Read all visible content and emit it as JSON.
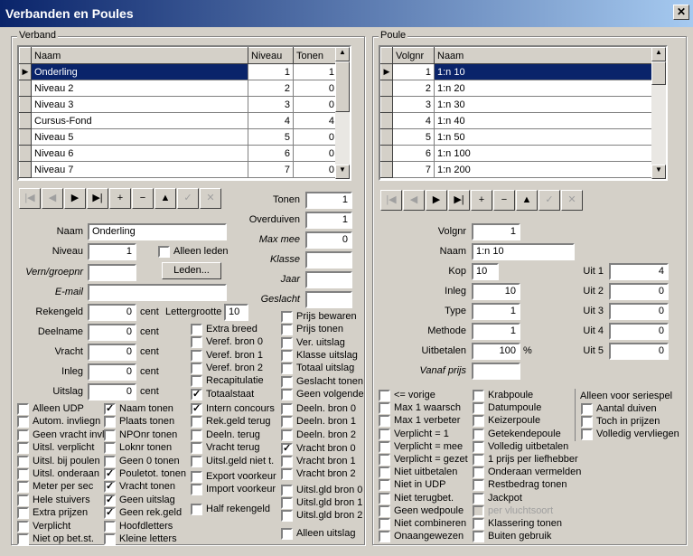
{
  "window": {
    "title": "Verbanden en Poules",
    "close": "✕"
  },
  "verband": {
    "legend": "Verband",
    "columns": [
      "Naam",
      "Niveau",
      "Tonen"
    ],
    "rows": [
      {
        "naam": "Onderling",
        "niveau": "1",
        "tonen": "1"
      },
      {
        "naam": "Niveau 2",
        "niveau": "2",
        "tonen": "0"
      },
      {
        "naam": "Niveau 3",
        "niveau": "3",
        "tonen": "0"
      },
      {
        "naam": "Cursus-Fond",
        "niveau": "4",
        "tonen": "4"
      },
      {
        "naam": "Niveau 5",
        "niveau": "5",
        "tonen": "0"
      },
      {
        "naam": "Niveau 6",
        "niveau": "6",
        "tonen": "0"
      },
      {
        "naam": "Niveau 7",
        "niveau": "7",
        "tonen": "0"
      }
    ],
    "fields": {
      "naam_label": "Naam",
      "naam": "Onderling",
      "niveau_label": "Niveau",
      "niveau": "1",
      "alleen_leden": "Alleen leden",
      "verenr_label": "Vern/groepnr",
      "verenr": "",
      "leden_button": "Leden...",
      "email_label": "E-mail",
      "email": "",
      "rekengeld_label": "Rekengeld",
      "rekengeld": "0",
      "deelname_label": "Deelname",
      "deelname": "0",
      "vracht_label": "Vracht",
      "vracht": "0",
      "inleg_label": "Inleg",
      "inleg": "0",
      "uitslag_label": "Uitslag",
      "uitslag": "0",
      "cent": "cent",
      "lettergrootte_label": "Lettergrootte",
      "lettergrootte": "10",
      "tonen_label": "Tonen",
      "tonen": "1",
      "overduiven_label": "Overduiven",
      "overduiven": "1",
      "maxmee_label": "Max mee",
      "maxmee": "0",
      "klasse_label": "Klasse",
      "klasse": "",
      "jaar_label": "Jaar",
      "jaar": "",
      "geslacht_label": "Geslacht",
      "geslacht": ""
    },
    "checks_mid": [
      {
        "label": "Extra breed",
        "checked": false
      },
      {
        "label": "Veref. bron 0",
        "checked": false
      },
      {
        "label": "Veref. bron 1",
        "checked": false
      },
      {
        "label": "Veref. bron 2",
        "checked": false
      },
      {
        "label": "Recapitulatie",
        "checked": false
      },
      {
        "label": "Totaalstaat",
        "checked": true
      }
    ],
    "checks_right_top": [
      {
        "label": "Prijs bewaren",
        "checked": false
      },
      {
        "label": "Prijs tonen",
        "checked": false
      },
      {
        "label": "Ver. uitslag",
        "checked": false
      },
      {
        "label": "Klasse uitslag",
        "checked": false
      },
      {
        "label": "Totaal uitslag",
        "checked": false
      },
      {
        "label": "Geslacht tonen",
        "checked": false
      },
      {
        "label": "Geen volgende",
        "checked": false
      }
    ],
    "col1": [
      {
        "label": "Alleen UDP",
        "checked": false
      },
      {
        "label": "Autom. invliegn",
        "checked": false
      },
      {
        "label": "Geen vracht invl",
        "checked": false
      },
      {
        "label": "Uitsl. verplicht",
        "checked": false
      },
      {
        "label": "Uitsl. bij poulen",
        "checked": false
      },
      {
        "label": "Uitsl. onderaan",
        "checked": false
      },
      {
        "label": "Meter per sec",
        "checked": false
      },
      {
        "label": "Hele stuivers",
        "checked": false
      },
      {
        "label": "Extra prijzen",
        "checked": false
      },
      {
        "label": "Verplicht",
        "checked": false
      },
      {
        "label": "Niet op bet.st.",
        "checked": false
      }
    ],
    "col2": [
      {
        "label": "Naam tonen",
        "checked": true
      },
      {
        "label": "Plaats tonen",
        "checked": false
      },
      {
        "label": "NPOnr tonen",
        "checked": false
      },
      {
        "label": "Loknr tonen",
        "checked": false
      },
      {
        "label": "Geen 0 tonen",
        "checked": false
      },
      {
        "label": "Pouletot. tonen",
        "checked": true
      },
      {
        "label": "Vracht tonen",
        "checked": true
      },
      {
        "label": "Geen uitslag",
        "checked": true
      },
      {
        "label": "Geen rek.geld",
        "checked": true
      },
      {
        "label": "Hoofdletters",
        "checked": false
      },
      {
        "label": "Kleine letters",
        "checked": false
      }
    ],
    "col3": [
      {
        "label": "Intern concours",
        "checked": true
      },
      {
        "label": "Rek.geld terug",
        "checked": false
      },
      {
        "label": "Deeln. terug",
        "checked": false
      },
      {
        "label": "Vracht terug",
        "checked": false
      },
      {
        "label": "Uitsl.geld niet t.",
        "checked": false
      }
    ],
    "col3b": [
      {
        "label": "Export voorkeur",
        "checked": false
      },
      {
        "label": "Import voorkeur",
        "checked": false
      }
    ],
    "col3c": [
      {
        "label": "Half rekengeld",
        "checked": false
      }
    ],
    "col4": [
      {
        "label": "Deeln. bron 0",
        "checked": false
      },
      {
        "label": "Deeln. bron 1",
        "checked": false
      },
      {
        "label": "Deeln. bron 2",
        "checked": false
      },
      {
        "label": "Vracht bron 0",
        "checked": true
      },
      {
        "label": "Vracht bron 1",
        "checked": false
      },
      {
        "label": "Vracht bron 2",
        "checked": false
      },
      {
        "label": "Uitsl.gld bron 0",
        "checked": false
      },
      {
        "label": "Uitsl.gld bron 1",
        "checked": false
      },
      {
        "label": "Uitsl.gld bron 2",
        "checked": false
      },
      {
        "label": "Alleen uitslag",
        "checked": false
      }
    ]
  },
  "poule": {
    "legend": "Poule",
    "columns": [
      "Volgnr",
      "Naam"
    ],
    "rows": [
      {
        "volgnr": "1",
        "naam": "1:n  10"
      },
      {
        "volgnr": "2",
        "naam": "1:n  20"
      },
      {
        "volgnr": "3",
        "naam": "1:n  30"
      },
      {
        "volgnr": "4",
        "naam": "1:n  40"
      },
      {
        "volgnr": "5",
        "naam": "1:n  50"
      },
      {
        "volgnr": "6",
        "naam": "1:n 100"
      },
      {
        "volgnr": "7",
        "naam": "1:n 200"
      }
    ],
    "fields": {
      "volgnr_label": "Volgnr",
      "volgnr": "1",
      "naam_label": "Naam",
      "naam": "1:n  10",
      "kop_label": "Kop",
      "kop": "10",
      "inleg_label": "Inleg",
      "inleg": "10",
      "type_label": "Type",
      "type": "1",
      "methode_label": "Methode",
      "methode": "1",
      "uitbetalen_label": "Uitbetalen",
      "uitbetalen": "100",
      "percent": "%",
      "vanafprijs_label": "Vanaf prijs",
      "vanafprijs": "",
      "uit1_label": "Uit 1",
      "uit1": "4",
      "uit2_label": "Uit 2",
      "uit2": "0",
      "uit3_label": "Uit 3",
      "uit3": "0",
      "uit4_label": "Uit 4",
      "uit4": "0",
      "uit5_label": "Uit 5",
      "uit5": "0"
    },
    "col1": [
      {
        "label": "<= vorige",
        "checked": false
      },
      {
        "label": "Max 1 waarsch",
        "checked": false
      },
      {
        "label": "Max 1 verbeter",
        "checked": false
      },
      {
        "label": "Verplicht = 1",
        "checked": false
      },
      {
        "label": "Verplicht = mee",
        "checked": false
      },
      {
        "label": "Verplicht = gezet",
        "checked": false
      },
      {
        "label": "Niet uitbetalen",
        "checked": false
      },
      {
        "label": "Niet in UDP",
        "checked": false
      },
      {
        "label": "Niet terugbet.",
        "checked": false
      },
      {
        "label": "Geen wedpoule",
        "checked": false
      },
      {
        "label": "Niet combineren",
        "checked": false
      },
      {
        "label": "Onaangewezen",
        "checked": false
      }
    ],
    "col2": [
      {
        "label": "Krabpoule",
        "checked": false
      },
      {
        "label": "Datumpoule",
        "checked": false
      },
      {
        "label": "Keizerpoule",
        "checked": false
      },
      {
        "label": "Getekendepoule",
        "checked": false
      },
      {
        "label": "Volledig uitbetalen",
        "checked": false
      },
      {
        "label": "1 prijs per liefhebber",
        "checked": false
      },
      {
        "label": "Onderaan vermelden",
        "checked": false
      },
      {
        "label": "Restbedrag tonen",
        "checked": false
      },
      {
        "label": "Jackpot",
        "checked": false
      },
      {
        "label": "per vluchtsoort",
        "checked": false,
        "disabled": true
      },
      {
        "label": "Klassering tonen",
        "checked": false
      },
      {
        "label": "Buiten gebruik",
        "checked": false
      }
    ],
    "serie_heading": "Alleen voor seriespel",
    "col3": [
      {
        "label": "Aantal duiven",
        "checked": false
      },
      {
        "label": "Toch in prijzen",
        "checked": false
      },
      {
        "label": "Volledig vervliegen",
        "checked": false
      }
    ]
  },
  "nav": {
    "first": "|◀",
    "prev": "◀",
    "next": "▶",
    "last": "▶|",
    "insert": "+",
    "delete": "−",
    "edit": "▲",
    "post": "✓",
    "cancel": "✕"
  }
}
